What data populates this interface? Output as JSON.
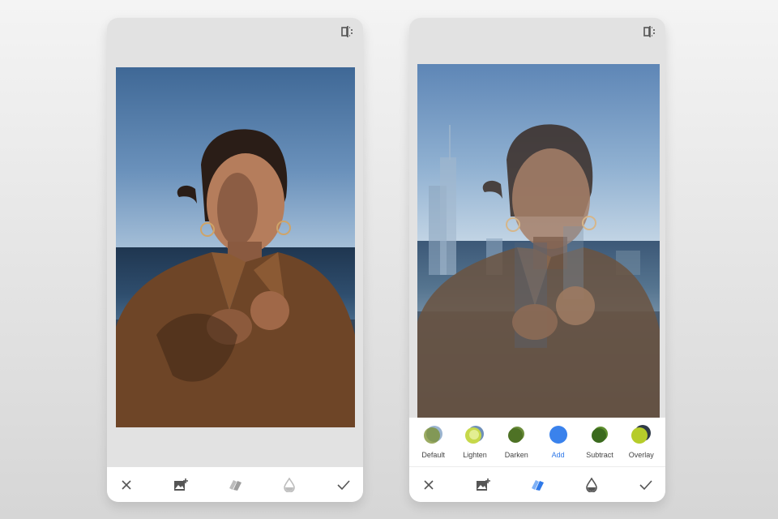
{
  "left_screen": {
    "toolbar": [
      "close",
      "add-image",
      "blend-modes",
      "opacity",
      "apply"
    ]
  },
  "right_screen": {
    "blend_modes": [
      {
        "label": "Default",
        "color_a": "#7a8f2e",
        "color_b": "#9bb4d0"
      },
      {
        "label": "Lighten",
        "color_a": "#c6d84a",
        "color_b": "#6e8fb8"
      },
      {
        "label": "Darken",
        "color_a": "#4e7225",
        "color_b": "#6b8d3b"
      },
      {
        "label": "Add",
        "color_a": "#3a82ec",
        "color_b": "#3a82ec"
      },
      {
        "label": "Subtract",
        "color_a": "#3b6a1e",
        "color_b": "#5d8e2e"
      },
      {
        "label": "Overlay",
        "color_a": "#b6cc2a",
        "color_b": "#2f3a46"
      }
    ],
    "active_mode": "Add",
    "toolbar": [
      "close",
      "add-image",
      "blend-modes",
      "opacity",
      "apply"
    ]
  },
  "colors": {
    "accent": "#2f79e8",
    "toolbar_bg": "#ffffff",
    "canvas_bg": "#e2e2e2"
  }
}
